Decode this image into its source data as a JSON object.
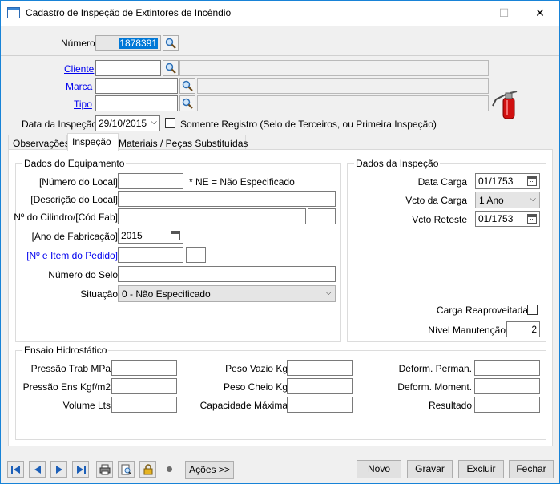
{
  "window": {
    "title": "Cadastro de Inspeção de Extintores de Incêndio",
    "minimize": "—",
    "maximize": "☐",
    "close": "✕"
  },
  "header": {
    "numero_label": "Número",
    "numero_value": "1878391",
    "cliente_label": "Cliente",
    "marca_label": "Marca",
    "tipo_label": "Tipo",
    "data_label": "Data da Inspeção",
    "data_value": "29/10/2015",
    "somente_label": "Somente Registro (Selo de Terceiros, ou Primeira Inspeção)"
  },
  "tabs": [
    {
      "label": "Observações"
    },
    {
      "label": "Inspeção"
    },
    {
      "label": "Materiais / Peças Substituídas"
    }
  ],
  "equipamento": {
    "title": "Dados do Equipamento",
    "numero_local_label": "[Número do Local]",
    "ne_note": "* NE = Não Especificado",
    "descricao_label": "[Descrição do Local]",
    "cilindro_label": "Nº do Cilindro/[Cód Fab]",
    "ano_label": "[Ano de Fabricação]",
    "ano_value": "2015",
    "pedido_label": "[Nº e Item do Pedido]",
    "selo_label": "Número do Selo",
    "situacao_label": "Situação",
    "situacao_value": "0 - Não Especificado"
  },
  "inspecao": {
    "title": "Dados da Inspeção",
    "data_carga_label": "Data Carga",
    "data_carga_value": "01/1753",
    "vcto_carga_label": "Vcto da Carga",
    "vcto_carga_value": "1 Ano",
    "vcto_reteste_label": "Vcto Reteste",
    "vcto_reteste_value": "01/1753",
    "carga_reap_label": "Carga Reaproveitada",
    "nivel_label": "Nível Manutenção",
    "nivel_value": "2"
  },
  "hidro": {
    "title": "Ensaio Hidrostático",
    "pressao_trab": "Pressão Trab MPa",
    "pressao_ens": "Pressão Ens Kgf/m2",
    "volume": "Volume Lts",
    "peso_vazio": "Peso Vazio Kg",
    "peso_cheio": "Peso Cheio Kg",
    "capacidade": "Capacidade Máxima",
    "deform_perm": "Deform. Perman.",
    "deform_mom": "Deform. Moment.",
    "resultado": "Resultado"
  },
  "footer": {
    "acoes": "Ações >>",
    "novo": "Novo",
    "gravar": "Gravar",
    "excluir": "Excluir",
    "fechar": "Fechar"
  },
  "colors": {
    "accent": "#1883d7",
    "link": "#0000ee",
    "extinguisher": "#d01010"
  }
}
